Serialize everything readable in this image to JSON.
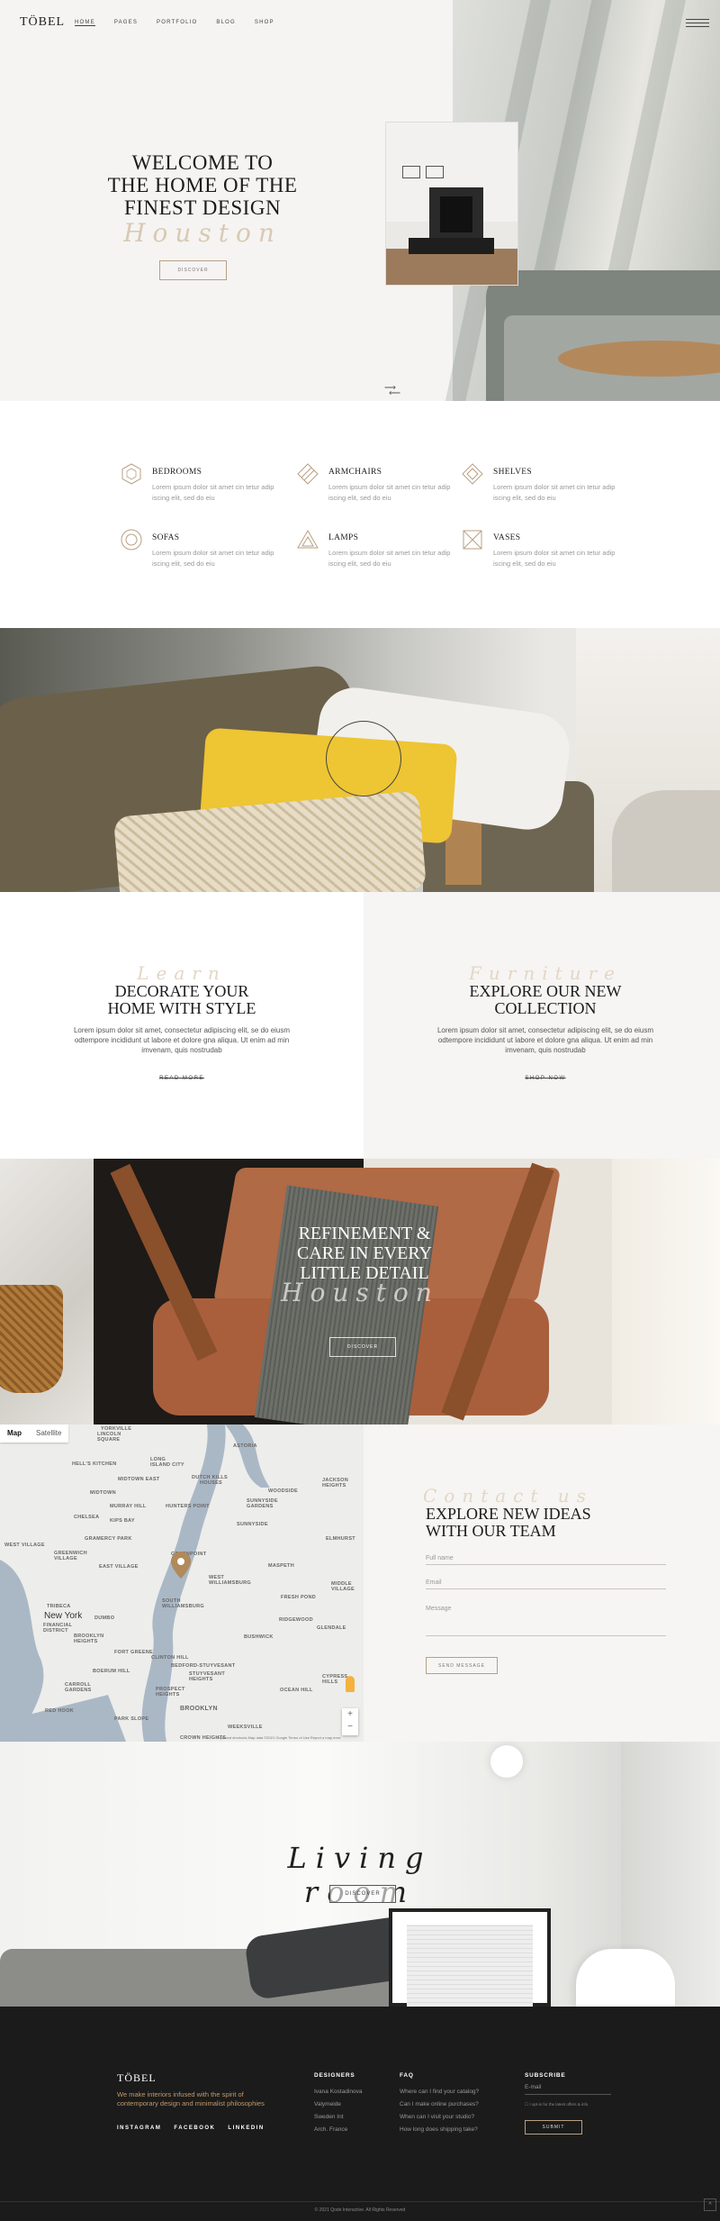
{
  "header": {
    "logo": "TÖBEL",
    "nav": [
      "HOME",
      "PAGES",
      "PORTFOLIO",
      "BLOG",
      "SHOP"
    ],
    "active_nav": "HOME"
  },
  "hero": {
    "title_line1": "WELCOME TO",
    "title_line2": "THE HOME OF THE",
    "title_line3": "FINEST DESIGN",
    "script": "Houston",
    "button": "DISCOVER",
    "arrows": "⟶"
  },
  "categories": [
    {
      "title": "BEDROOMS",
      "text": "Lorem ipsum dolor sit amet cin tetur adip iscing elit, sed do eiu",
      "icon": "hexagon-icon"
    },
    {
      "title": "ARMCHAIRS",
      "text": "Lorem ipsum dolor sit amet cin tetur adip iscing elit, sed do eiu",
      "icon": "diagonal-lines-icon"
    },
    {
      "title": "SHELVES",
      "text": "Lorem ipsum dolor sit amet cin tetur adip iscing elit, sed do eiu",
      "icon": "diamond-icon"
    },
    {
      "title": "SOFAS",
      "text": "Lorem ipsum dolor sit amet cin tetur adip iscing elit, sed do eiu",
      "icon": "circle-icon"
    },
    {
      "title": "LAMPS",
      "text": "Lorem ipsum dolor sit amet cin tetur adip iscing elit, sed do eiu",
      "icon": "triangle-icon"
    },
    {
      "title": "VASES",
      "text": "Lorem ipsum dolor sit amet cin tetur adip iscing elit, sed do eiu",
      "icon": "square-cross-icon"
    }
  ],
  "promo_left": {
    "script": "Learn",
    "title_line1": "DECORATE YOUR",
    "title_line2": "HOME WITH STYLE",
    "text": "Lorem ipsum dolor sit amet, consectetur adipiscing elit, se do eiusm odtempore incididunt ut labore et dolore gna aliqua. Ut enim ad min imvenam, quis nostrudab",
    "link": "READ MORE"
  },
  "promo_right": {
    "script": "Furniture",
    "title_line1": "EXPLORE OUR NEW",
    "title_line2": "COLLECTION",
    "text": "Lorem ipsum dolor sit amet, consectetur adipiscing elit, se do eiusm odtempore incididunt ut labore et dolore gna aliqua. Ut enim ad min imvenam, quis nostrudab",
    "link": "SHOP NOW"
  },
  "chair_banner": {
    "title_line1": "REFINEMENT &",
    "title_line2": "CARE IN EVERY",
    "title_line3": "LITTLE DETAIL",
    "script": "Houston",
    "button": "DISCOVER"
  },
  "map": {
    "tab_map": "Map",
    "tab_satellite": "Satellite",
    "labels": [
      "YORKVILLE",
      "LINCOLN SQUARE",
      "ASTORIA",
      "HELL'S KITCHEN",
      "LONG ISLAND CITY",
      "MIDTOWN EAST",
      "DUTCH KILLS",
      "HOUSES",
      "JACKSON HEIGHTS",
      "MIDTOWN",
      "MURRAY HILL",
      "SUNNYSIDE GARDENS",
      "WOODSIDE",
      "HUNTERS POINT",
      "CHELSEA",
      "KIPS BAY",
      "WEST VILLAGE",
      "SUNNYSIDE",
      "GRAMERCY PARK",
      "ELMHURST",
      "GREENWICH VILLAGE",
      "GREENPOINT",
      "EAST VILLAGE",
      "MASPETH",
      "WEST WILLIAMSBURG",
      "MIDDLE VILLAGE",
      "FRESH POND",
      "SOUTH WILLIAMSBURG",
      "DUMBO",
      "RIDGEWOOD",
      "BROOKLYN HEIGHTS",
      "BUSHWICK",
      "GLENDALE",
      "FORT GREENE",
      "CLINTON HILL",
      "BOERUM HILL",
      "BEDFORD-STUYVESANT",
      "STUYVESANT HEIGHTS",
      "CYPRESS HILLS",
      "CARROLL GARDENS",
      "PROSPECT HEIGHTS",
      "OCEAN HILL",
      "RED HOOK",
      "PARK SLOPE",
      "CROWN HEIGHTS",
      "WEEKSVILLE",
      "TRIBECA",
      "FINANCIAL DISTRICT"
    ],
    "city_new_york": "New York",
    "city_brooklyn": "BROOKLYN",
    "footer": "Keyboard shortcuts   Map data ©2021 Google   Terms of Use   Report a map error"
  },
  "contact": {
    "script": "Contact us",
    "title_line1": "EXPLORE NEW IDEAS",
    "title_line2": "WITH OUR TEAM",
    "fields": [
      "Full name",
      "Email",
      "Message"
    ],
    "button": "SEND MESSAGE"
  },
  "living": {
    "script": "Living room",
    "button": "DISCOVER"
  },
  "footer": {
    "logo": "TÖBEL",
    "description": "We make interiors infused with the spirit of contemporary design and minimalist philosophies",
    "social": [
      "INSTAGRAM",
      "FACEBOOK",
      "LINKEDIN"
    ],
    "designers_title": "DESIGNERS",
    "designers": [
      "Ivana Kostadinova",
      "Valymeide",
      "Sweden Int",
      "Arch. France"
    ],
    "faq_title": "FAQ",
    "faq": [
      "Where can I find your catalog?",
      "Can I make online purchases?",
      "When can I visit your studio?",
      "How long does shipping take?"
    ],
    "subscribe_title": "SUBSCRIBE",
    "email_placeholder": "E-mail",
    "checkbox_text": "I opt-in for the latest offers & info",
    "subscribe_button": "SUBMIT",
    "copyright": "© 2021 Qode Interactive. All Rights Reserved",
    "to_top": "^"
  }
}
